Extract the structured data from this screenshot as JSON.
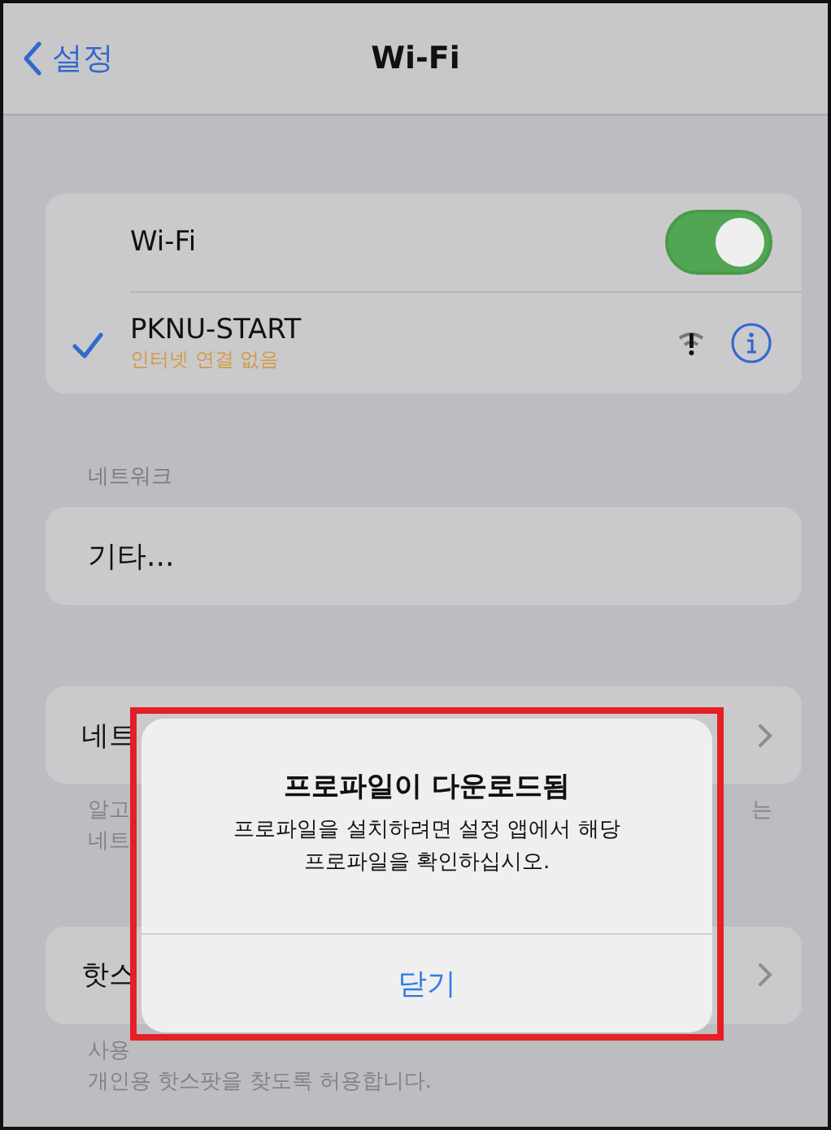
{
  "nav": {
    "back_label": "설정",
    "title": "Wi-Fi"
  },
  "wifi_card": {
    "toggle": {
      "label": "Wi-Fi",
      "on": true
    },
    "network": {
      "name": "PKNU-START",
      "status": "인터넷 연결 없음",
      "connected": true
    }
  },
  "networks_section": {
    "header": "네트워크",
    "items": [
      {
        "label": "기타..."
      }
    ]
  },
  "settings_rows": [
    {
      "left": "네트",
      "note_lines": [
        "알고",
        "네트"
      ],
      "note_right": "는"
    },
    {
      "left": "핫스",
      "note_lines": [
        "사용",
        "개인용 핫스팟을 찾도록 허용합니다."
      ]
    }
  ],
  "alert": {
    "title": "프로파일이 다운로드됨",
    "message": "프로파일을 설치하려면 설정 앱에서 해당\n프로파일을 확인하십시오.",
    "button": "닫기"
  }
}
